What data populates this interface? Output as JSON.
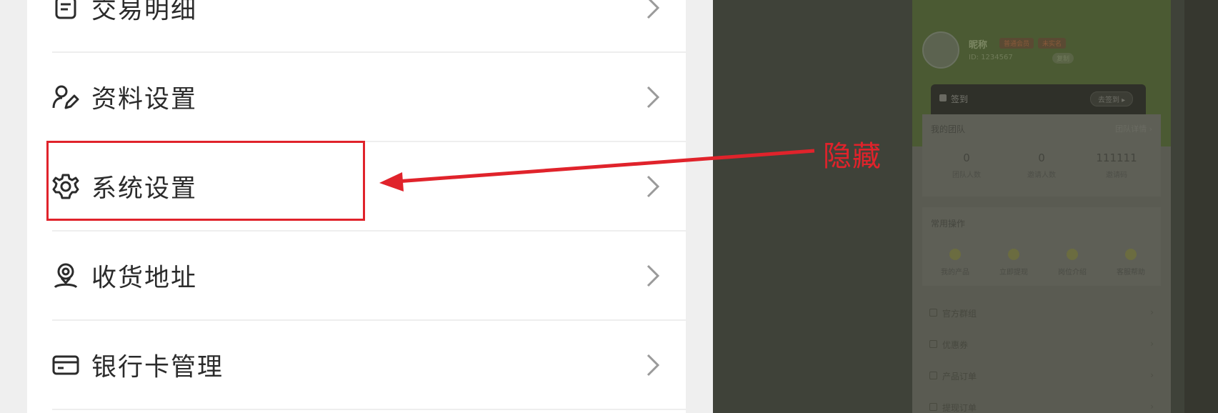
{
  "left_menu": {
    "items": [
      {
        "label": "交易明细",
        "icon": "document-icon"
      },
      {
        "label": "资料设置",
        "icon": "user-edit-icon"
      },
      {
        "label": "系统设置",
        "icon": "gear-icon"
      },
      {
        "label": "收货地址",
        "icon": "location-person-icon"
      },
      {
        "label": "银行卡管理",
        "icon": "bank-card-icon"
      }
    ]
  },
  "annotation": {
    "label": "隐藏",
    "color": "#e0232b"
  },
  "right_screen": {
    "profile": {
      "name": "昵称",
      "badges": [
        "普通会员",
        "未实名"
      ],
      "id": "ID: 1234567",
      "copy": "复制"
    },
    "checkin": {
      "label": "签到",
      "button": "去签到 ▸"
    },
    "team": {
      "title": "我的团队",
      "more": "团队详情 ›",
      "stats": [
        {
          "value": "0",
          "label": "团队人数"
        },
        {
          "value": "0",
          "label": "邀请人数"
        },
        {
          "value": "111111",
          "label": "邀请码"
        }
      ]
    },
    "ops": {
      "title": "常用操作",
      "items": [
        "我的产品",
        "立即提现",
        "岗位介绍",
        "客服帮助"
      ]
    },
    "list": [
      {
        "label": "官方群组"
      },
      {
        "label": "优惠券"
      },
      {
        "label": "产品订单"
      },
      {
        "label": "提现订单"
      }
    ]
  }
}
